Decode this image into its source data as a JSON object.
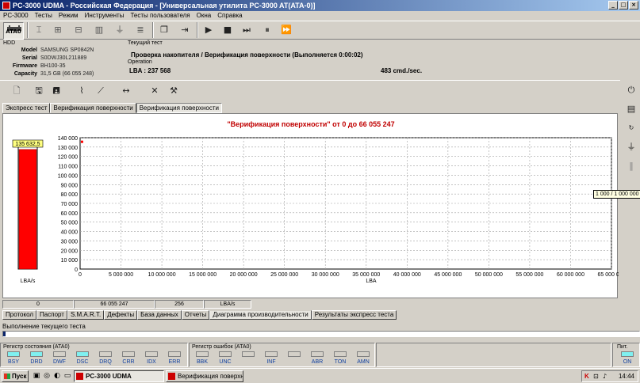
{
  "window": {
    "title": "PC-3000 UDMA - Российская Федерация - [Универсальная утилита PC-3000 AT(ATA-0)]",
    "controls": [
      "_",
      "□",
      "×"
    ]
  },
  "menu": [
    "PC-3000",
    "Тесты",
    "Режим",
    "Инструменты",
    "Тесты пользователя",
    "Окна",
    "Справка"
  ],
  "toolbar": {
    "ata_label": "ATA0"
  },
  "hdd": {
    "section_label": "HDD",
    "model_label": "Model",
    "model": "SAMSUNG SP0842N",
    "serial_label": "Serial",
    "serial": "S0DWJ30L211889",
    "firmware_label": "Firmware",
    "firmware": "BH100-35",
    "capacity_label": "Capacity",
    "capacity": "31,5 GB (66 055 248)"
  },
  "test": {
    "section_label": "Текущий тест",
    "current": "Проверка накопителя / Верификация поверхности (Выполняется 0:00:02)",
    "operation_label": "Operation",
    "lba": "LBA : 237 568",
    "rate": "483 cmd./sec."
  },
  "tabs_top": [
    "Экспресс тест",
    "Верификация поверхности",
    "Верификация поверхности"
  ],
  "tabs_top_active": 2,
  "chart_data": {
    "type": "line",
    "title": "\"Верификация поверхности\" от 0 до 66 055 247",
    "xlabel": "LBA",
    "xlim": [
      0,
      65000000
    ],
    "ylim": [
      0,
      140000
    ],
    "x_ticks": [
      "0",
      "5 000 000",
      "10 000 000",
      "15 000 000",
      "20 000 000",
      "25 000 000",
      "30 000 000",
      "35 000 000",
      "40 000 000",
      "45 000 000",
      "50 000 000",
      "55 000 000",
      "60 000 000",
      "65 000 000"
    ],
    "y_ticks": [
      "0",
      "10 000",
      "20 000",
      "30 000",
      "40 000",
      "50 000",
      "60 000",
      "70 000",
      "80 000",
      "90 000",
      "100 000",
      "110 000",
      "120 000",
      "130 000",
      "140 000"
    ],
    "grid": true,
    "points": [
      {
        "x": 237568,
        "y": 135632.5
      }
    ],
    "series_color": "#ff0000",
    "gauge": {
      "value": 135632.5,
      "label": "135 632,5",
      "unit": "LBA/s",
      "max": 140000
    }
  },
  "tooltip": "1 000 / 1 000 000",
  "status_fields": [
    "0",
    "66 055 247",
    "256",
    "LBA/s"
  ],
  "tabs_bottom": [
    "Протокол",
    "Паспорт",
    "S.M.A.R.T.",
    "Дефекты",
    "База данных",
    "Отчеты",
    "Диаграмма производительности",
    "Результаты экспресс теста"
  ],
  "tabs_bottom_active": 6,
  "progress": {
    "label": "Выполнение текущего теста",
    "fraction": 0.004
  },
  "status_register": {
    "title": "Регистр состояния (ATA0)",
    "leds": [
      {
        "name": "BSY",
        "on": true
      },
      {
        "name": "DRD",
        "on": true
      },
      {
        "name": "DWF",
        "on": false
      },
      {
        "name": "DSC",
        "on": true
      },
      {
        "name": "DRQ",
        "on": false
      },
      {
        "name": "CRR",
        "on": false
      },
      {
        "name": "IDX",
        "on": false
      },
      {
        "name": "ERR",
        "on": false
      }
    ]
  },
  "error_register": {
    "title": "Регистр ошибок (ATA0)",
    "leds": [
      {
        "name": "BBK",
        "on": false
      },
      {
        "name": "UNC",
        "on": false
      },
      {
        "name": "",
        "on": false
      },
      {
        "name": "INF",
        "on": false
      },
      {
        "name": "",
        "on": false
      },
      {
        "name": "ABR",
        "on": false
      },
      {
        "name": "TON",
        "on": false
      },
      {
        "name": "AMN",
        "on": false
      }
    ]
  },
  "power": {
    "title": "Пит.",
    "led": "ON",
    "on": true
  },
  "taskbar": {
    "start": "Пуск",
    "tasks": [
      "PC-3000 UDMA",
      "Верификация поверхно..."
    ],
    "active_task": 0,
    "clock": "14:44"
  },
  "icons": {
    "toolbar1": [
      "drive-icon",
      "tool-icon",
      "chart-icon",
      "chip-icon",
      "stack-icon",
      "windows-icon",
      "exit-icon",
      "play-icon",
      "stop-icon",
      "step-icon",
      "pause-icon",
      "fast-forward-icon"
    ],
    "toolbar2": [
      "open-icon",
      "save-icon",
      "save-as-icon",
      "chart-view-icon",
      "zoom-icon",
      "range-icon",
      "settings-icon",
      "options-icon"
    ],
    "right": [
      "power-icon",
      "cable-icon",
      "reset-icon",
      "plug-icon",
      "pause-bars-icon"
    ]
  }
}
